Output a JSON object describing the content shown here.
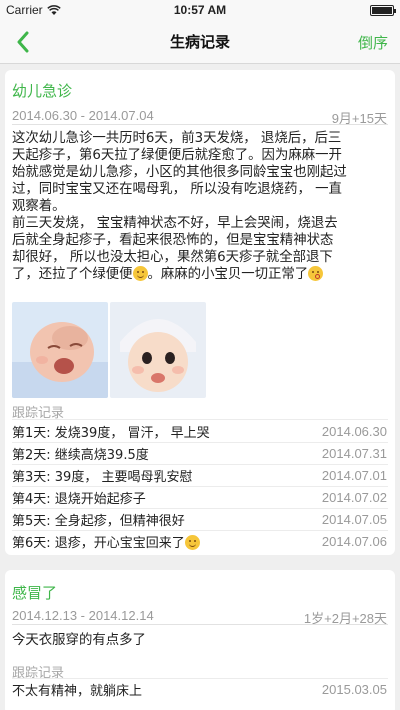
{
  "status": {
    "carrier": "Carrier",
    "time": "10:57 AM"
  },
  "nav": {
    "title": "生病记录",
    "right": "倒序"
  },
  "records": [
    {
      "title": "幼儿急诊",
      "date_range": "2014.06.30 - 2014.07.04",
      "age": "9月+15天",
      "lines": [
        "这次幼儿急诊一共历时6天，前3天发烧， 退烧后，后三",
        "天起疹子，第6天拉了绿便便后就痊愈了。因为麻麻一开",
        "始就感觉是幼儿急疹，小区的其他很多同龄宝宝也刚起过",
        "过，同时宝宝又还在喝母乳， 所以没有吃退烧药， 一直",
        "观察着。",
        "前三天发烧， 宝宝精神状态不好，早上会哭闹，烧退去",
        "后就全身起疹子，看起来很恐怖的，但是宝宝精神状态",
        "却很好， 所以也没太担心，果然第6天疹子就全部退下",
        "了，还拉了个绿便便",
        "。麻麻的小宝贝一切正常了"
      ],
      "track_label": "跟踪记录",
      "tracks": [
        {
          "text": "第1天: 发烧39度， 冒汗， 早上哭",
          "date": "2014.06.30"
        },
        {
          "text": "第2天: 继续高烧39.5度",
          "date": "2014.07.31"
        },
        {
          "text": "第3天: 39度， 主要喝母乳安慰",
          "date": "2014.07.01"
        },
        {
          "text": "第4天: 退烧开始起疹子",
          "date": "2014.07.02"
        },
        {
          "text": "第5天: 全身起疹，但精神很好",
          "date": "2014.07.05"
        },
        {
          "text": "第6天: 退疹，开心宝宝回来了",
          "date": "2014.07.06"
        }
      ]
    },
    {
      "title": "感冒了",
      "date_range": "2014.12.13 - 2014.12.14",
      "age": "1岁+2月+28天",
      "desc": "今天衣服穿的有点多了",
      "track_label": "跟踪记录",
      "tracks": [
        {
          "text": "不太有精神，就躺床上",
          "date": "2015.03.05"
        }
      ]
    }
  ]
}
